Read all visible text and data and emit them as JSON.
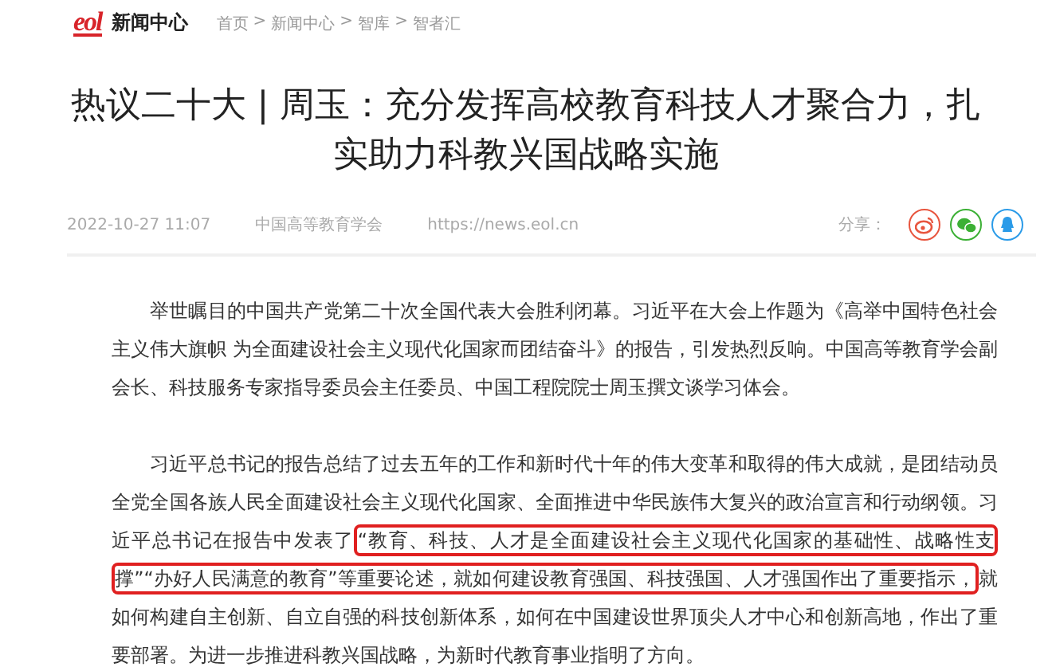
{
  "header": {
    "logo": "eol",
    "section": "新闻中心",
    "breadcrumb": [
      {
        "label": "首页"
      },
      {
        "label": "新闻中心"
      },
      {
        "label": "智库"
      },
      {
        "label": "智者汇"
      }
    ],
    "separator": ">"
  },
  "article": {
    "title": "热议二十大 | 周玉：充分发挥高校教育科技人才聚合力，扎实助力科教兴国战略实施",
    "meta": {
      "date": "2022-10-27 11:07",
      "source": "中国高等教育学会",
      "url": "https://news.eol.cn",
      "share_label": "分享："
    },
    "share_buttons": [
      {
        "kind": "weibo",
        "color": "#e8553e"
      },
      {
        "kind": "wechat",
        "color": "#3cb035"
      },
      {
        "kind": "qq",
        "color": "#2b9be8"
      }
    ],
    "paragraphs": [
      {
        "segments": [
          {
            "text": "举世瞩目的中国共产党第二十次全国代表大会胜利闭幕。习近平在大会上作题为《高举中国特色社会主义伟大旗帜 为全面建设社会主义现代化国家而团结奋斗》的报告，引发热烈反响。中国高等教育学会副会长、科技服务专家指导委员会主任委员、中国工程院院士周玉撰文谈学习体会。",
            "highlighted": false
          }
        ]
      },
      {
        "segments": [
          {
            "text": "习近平总书记的报告总结了过去五年的工作和新时代十年的伟大变革和取得的伟大成就，是团结动员全党全国各族人民全面建设社会主义现代化国家、全面推进中华民族伟大复兴的政治宣言和行动纲领。习近平总书记在报告中发表了",
            "highlighted": false
          },
          {
            "text": "“教育、科技、人才是全面建设社会主义现代化国家的基础性、战略性支撑”“办好人民满意的教育”等重要论述，就如何建设教育强国、科技强国、人才强国作出了重要指示，",
            "highlighted": true
          },
          {
            "text": "就如何构建自主创新、自立自强的科技创新体系，如何在中国建设世界顶尖人才中心和创新高地，作出了重要部署。为进一步推进科教兴国战略，为新时代教育事业指明了方向。",
            "highlighted": false
          }
        ]
      }
    ]
  }
}
